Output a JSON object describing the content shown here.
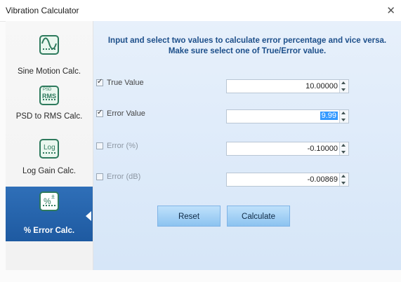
{
  "window": {
    "title": "Vibration Calculator"
  },
  "sidebar": {
    "items": [
      {
        "label": "Sine Motion Calc.",
        "icon": "sine-wave-icon"
      },
      {
        "label": "PSD to RMS Calc.",
        "icon": "psd-rms-icon",
        "icon_text_top": "PSD",
        "icon_text_main": "RMS"
      },
      {
        "label": "Log Gain Calc.",
        "icon": "log-gain-icon",
        "icon_text_main": "Log"
      },
      {
        "label": "% Error Calc.",
        "icon": "percent-error-icon",
        "icon_text_main": "%",
        "icon_text_sup": "±",
        "active": true
      }
    ]
  },
  "main": {
    "instruction_line1": "Input and select two values to calculate error percentage and vice versa.",
    "instruction_line2": "Make sure select one of True/Error value.",
    "rows": [
      {
        "label": "True Value",
        "checked": true,
        "value": "10.00000"
      },
      {
        "label": "Error Value",
        "checked": true,
        "value": "9.99",
        "selected": true
      },
      {
        "label": "Error (%)",
        "checked": false,
        "value": "-0.10000"
      },
      {
        "label": "Error (dB)",
        "checked": false,
        "value": "-0.00869"
      }
    ],
    "buttons": {
      "reset": "Reset",
      "calculate": "Calculate"
    }
  },
  "colors": {
    "accent": "#1e5aa1",
    "panel_bg": "#dce9f9",
    "button_bg": "#a9d3f6",
    "instruction_text": "#1d4f8a"
  }
}
